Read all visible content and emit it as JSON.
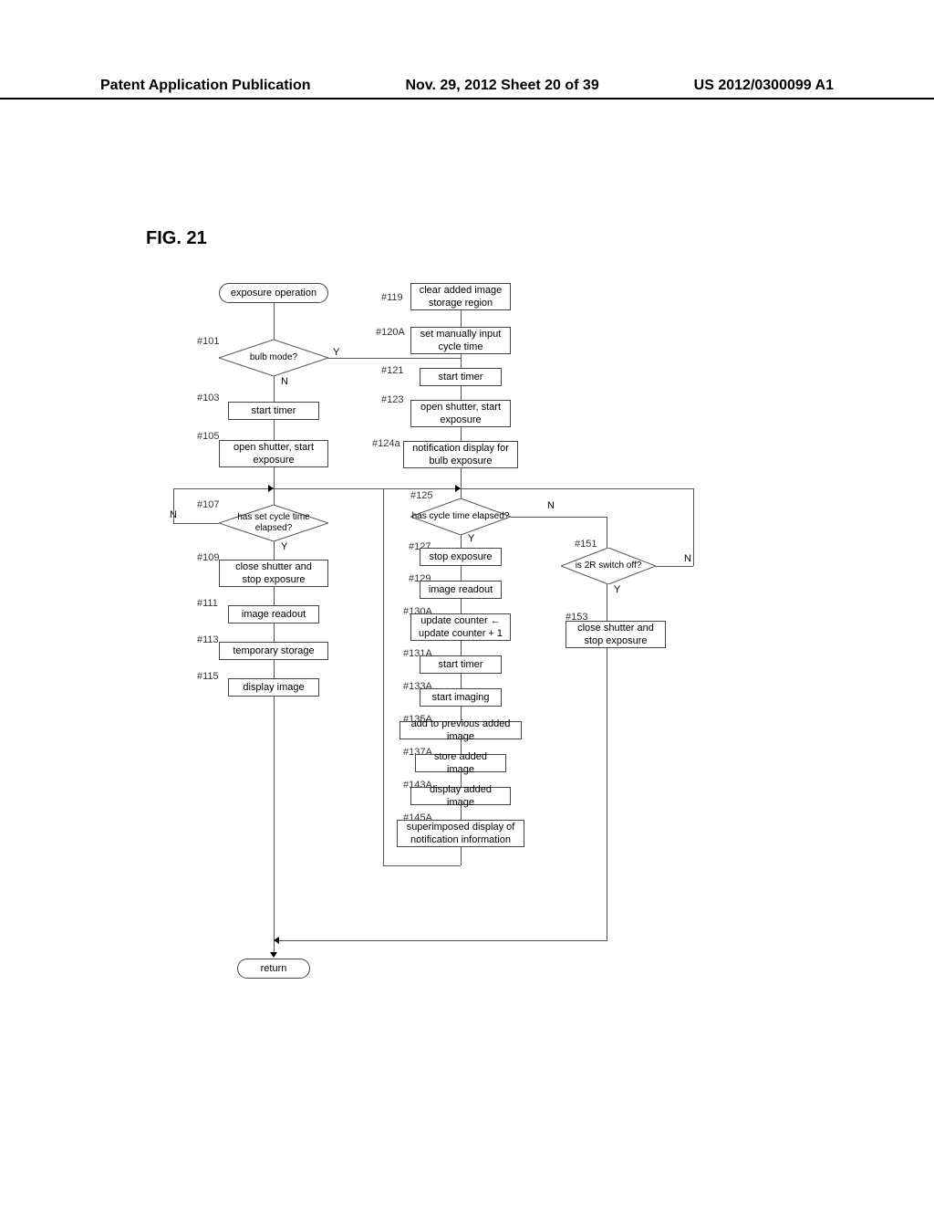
{
  "header": {
    "left": "Patent Application Publication",
    "center": "Nov. 29, 2012  Sheet 20 of 39",
    "right": "US 2012/0300099 A1"
  },
  "figure_label": "FIG. 21",
  "nodes": {
    "start": "exposure operation",
    "s101": {
      "id": "#101",
      "text": "bulb mode?"
    },
    "s103": {
      "id": "#103",
      "text": "start timer"
    },
    "s105": {
      "id": "#105",
      "text": "open shutter, start exposure"
    },
    "s107": {
      "id": "#107",
      "text": "has set cycle time elapsed?"
    },
    "s109": {
      "id": "#109",
      "text": "close shutter and stop exposure"
    },
    "s111": {
      "id": "#111",
      "text": "image readout"
    },
    "s113": {
      "id": "#113",
      "text": "temporary storage"
    },
    "s115": {
      "id": "#115",
      "text": "display image"
    },
    "s119": {
      "id": "#119",
      "text": "clear added image storage region"
    },
    "s120A": {
      "id": "#120A",
      "text": "set manually input cycle time"
    },
    "s121": {
      "id": "#121",
      "text": "start timer"
    },
    "s123": {
      "id": "#123",
      "text": "open shutter, start exposure"
    },
    "s124a": {
      "id": "#124a",
      "text": "notification display for bulb exposure"
    },
    "s125": {
      "id": "#125",
      "text": "has cycle time elapsed?"
    },
    "s127": {
      "id": "#127",
      "text": "stop exposure"
    },
    "s129": {
      "id": "#129",
      "text": "image readout"
    },
    "s130A": {
      "id": "#130A",
      "text": "update counter ← update counter + 1"
    },
    "s131A": {
      "id": "#131A",
      "text": "start timer"
    },
    "s133A": {
      "id": "#133A",
      "text": "start imaging"
    },
    "s135A": {
      "id": "#135A",
      "text": "add to previous added image"
    },
    "s137A": {
      "id": "#137A",
      "text": "store added image"
    },
    "s143A": {
      "id": "#143A",
      "text": "display added image"
    },
    "s145A": {
      "id": "#145A",
      "text": "superimposed display of notification information"
    },
    "s151": {
      "id": "#151",
      "text": "is 2R switch off?"
    },
    "s153": {
      "id": "#153",
      "text": "close shutter and stop exposure"
    },
    "return": "return"
  },
  "branches": {
    "yes": "Y",
    "no": "N"
  }
}
